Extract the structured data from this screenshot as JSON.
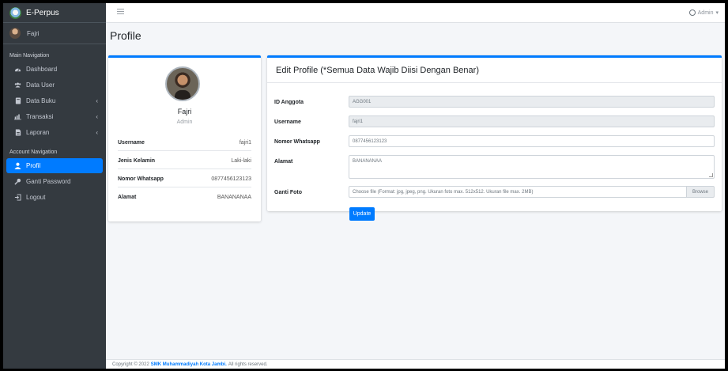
{
  "brand": {
    "name": "E-Perpus"
  },
  "user_panel": {
    "name": "Fajri"
  },
  "sidebar": {
    "main_header": "Main Navigation",
    "main_items": [
      {
        "label": "Dashboard",
        "icon": "dashboard-icon"
      },
      {
        "label": "Data User",
        "icon": "users-icon"
      },
      {
        "label": "Data Buku",
        "icon": "book-icon",
        "has_submenu": true
      },
      {
        "label": "Transaksi",
        "icon": "chart-icon",
        "has_submenu": true
      },
      {
        "label": "Laporan",
        "icon": "report-icon",
        "has_submenu": true
      }
    ],
    "account_header": "Account Navigation",
    "account_items": [
      {
        "label": "Profil",
        "icon": "user-icon",
        "active": true
      },
      {
        "label": "Ganti Password",
        "icon": "key-icon"
      },
      {
        "label": "Logout",
        "icon": "logout-icon"
      }
    ]
  },
  "topbar": {
    "user_label": "Admin"
  },
  "page": {
    "title": "Profile"
  },
  "profile_card": {
    "name": "Fajri",
    "role": "Admin",
    "rows": [
      {
        "key": "Username",
        "value": "fajri1"
      },
      {
        "key": "Jenis Kelamin",
        "value": "Laki-laki"
      },
      {
        "key": "Nomor Whatsapp",
        "value": "0877456123123"
      },
      {
        "key": "Alamat",
        "value": "BANANANAA"
      }
    ]
  },
  "edit_form": {
    "title": "Edit Profile (*Semua Data Wajib Diisi Dengan Benar)",
    "fields": {
      "id_anggota": {
        "label": "ID Anggota",
        "value": "AGG001"
      },
      "username": {
        "label": "Username",
        "value": "fajri1"
      },
      "whatsapp": {
        "label": "Nomor Whatsapp",
        "value": "0877456123123"
      },
      "alamat": {
        "label": "Alamat",
        "value": "BANANANAA"
      },
      "foto": {
        "label": "Ganti Foto",
        "placeholder": "Choose file (Format: jpg, jpeg, png. Ukuran foto max. 512x512. Ukuran file max. 2MB)",
        "browse_label": "Browse"
      }
    },
    "submit_label": "Update"
  },
  "footer": {
    "prefix": "Copyright © 2022",
    "org": "SMK Muhammadiyah Kota Jambi.",
    "suffix": "All rights reserved."
  },
  "colors": {
    "sidebar_bg": "#343a40",
    "accent": "#007bff",
    "content_bg": "#f4f6f9"
  }
}
